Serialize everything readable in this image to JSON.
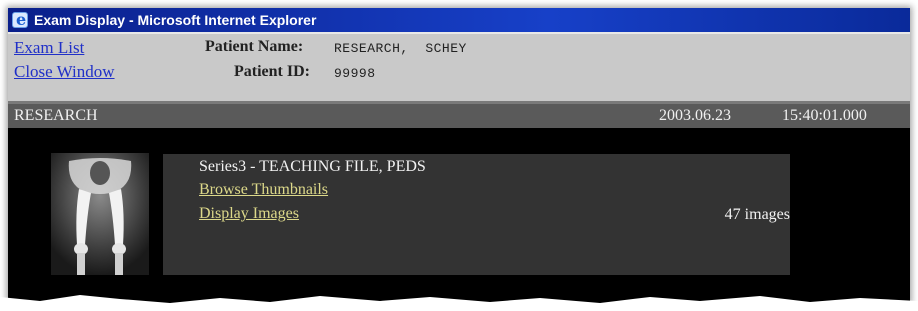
{
  "window": {
    "title": "Exam Display - Microsoft Internet Explorer",
    "icon": "ie-icon"
  },
  "header": {
    "links": {
      "exam_list": "Exam List",
      "close_window": "Close Window"
    },
    "patient_name_label": "Patient Name:",
    "patient_name_value": "RESEARCH,  SCHEY",
    "patient_id_label": "Patient ID:",
    "patient_id_value": "99998"
  },
  "exam": {
    "name": "RESEARCH",
    "date": "2003.06.23",
    "time": "15:40:01.000"
  },
  "series": [
    {
      "title": "Series3 - TEACHING FILE, PEDS",
      "browse_label": "Browse Thumbnails",
      "display_label": "Display Images",
      "image_count": "47 images",
      "thumbnail": "x-ray-thumbnail"
    }
  ]
}
